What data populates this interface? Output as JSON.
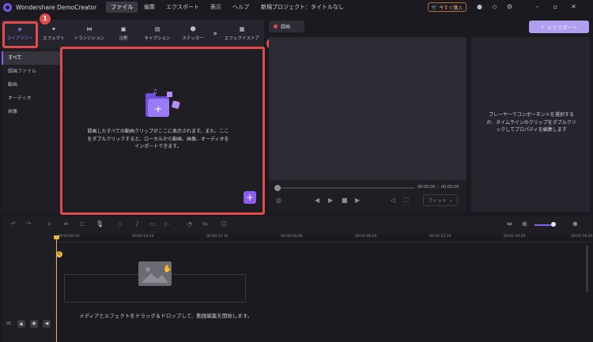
{
  "app": {
    "title": "Wondershare DemoCreator",
    "project_title": "新規プロジェクト：タイトルなし",
    "buy_label": "今すぐ購入"
  },
  "menu": [
    "ファイル",
    "編集",
    "エクスポート",
    "表示",
    "ヘルプ"
  ],
  "tabs": [
    {
      "label": "ライブラリー",
      "icon": "layers-icon"
    },
    {
      "label": "エフェクト",
      "icon": "sparkle-icon"
    },
    {
      "label": "トランジション",
      "icon": "transition-icon"
    },
    {
      "label": "注釈",
      "icon": "annotation-icon"
    },
    {
      "label": "キャプション",
      "icon": "caption-icon"
    },
    {
      "label": "ステッカー",
      "icon": "sticker-icon"
    },
    {
      "label": "エフェクトストア",
      "icon": "store-icon"
    }
  ],
  "sidebar": [
    "すべて",
    "録画ファイル",
    "動画",
    "オーディオ",
    "画像"
  ],
  "library": {
    "empty_message": "録画したすべての動画クリップがここに表示されます。また、ここをダブルクリックすると、ローカルから動画、画像、オーディオをインポートできます。"
  },
  "badges": [
    "1",
    "2"
  ],
  "preview": {
    "tab_label": "録画",
    "time_current": "00:00:00",
    "time_total": "00:00:00",
    "fit_label": "フィット"
  },
  "export": {
    "label": "エクスポート"
  },
  "properties": {
    "message": "プレーヤーでコンポーネントを選択するか、タイムラインのクリップをダブルクリックしてプロパティを編集します"
  },
  "timeline": {
    "ticks": [
      "00:00:00:00",
      "00:00:16:20",
      "00:00:33:10",
      "00:00:50:00",
      "00:01:06:20",
      "00:01:23:10",
      "00:01:40:00",
      "00:01:56:20"
    ],
    "drop_message": "メディアとエフェクトをドラッグ＆ドロップして、動画編集を開始します。",
    "track_number": "01"
  }
}
